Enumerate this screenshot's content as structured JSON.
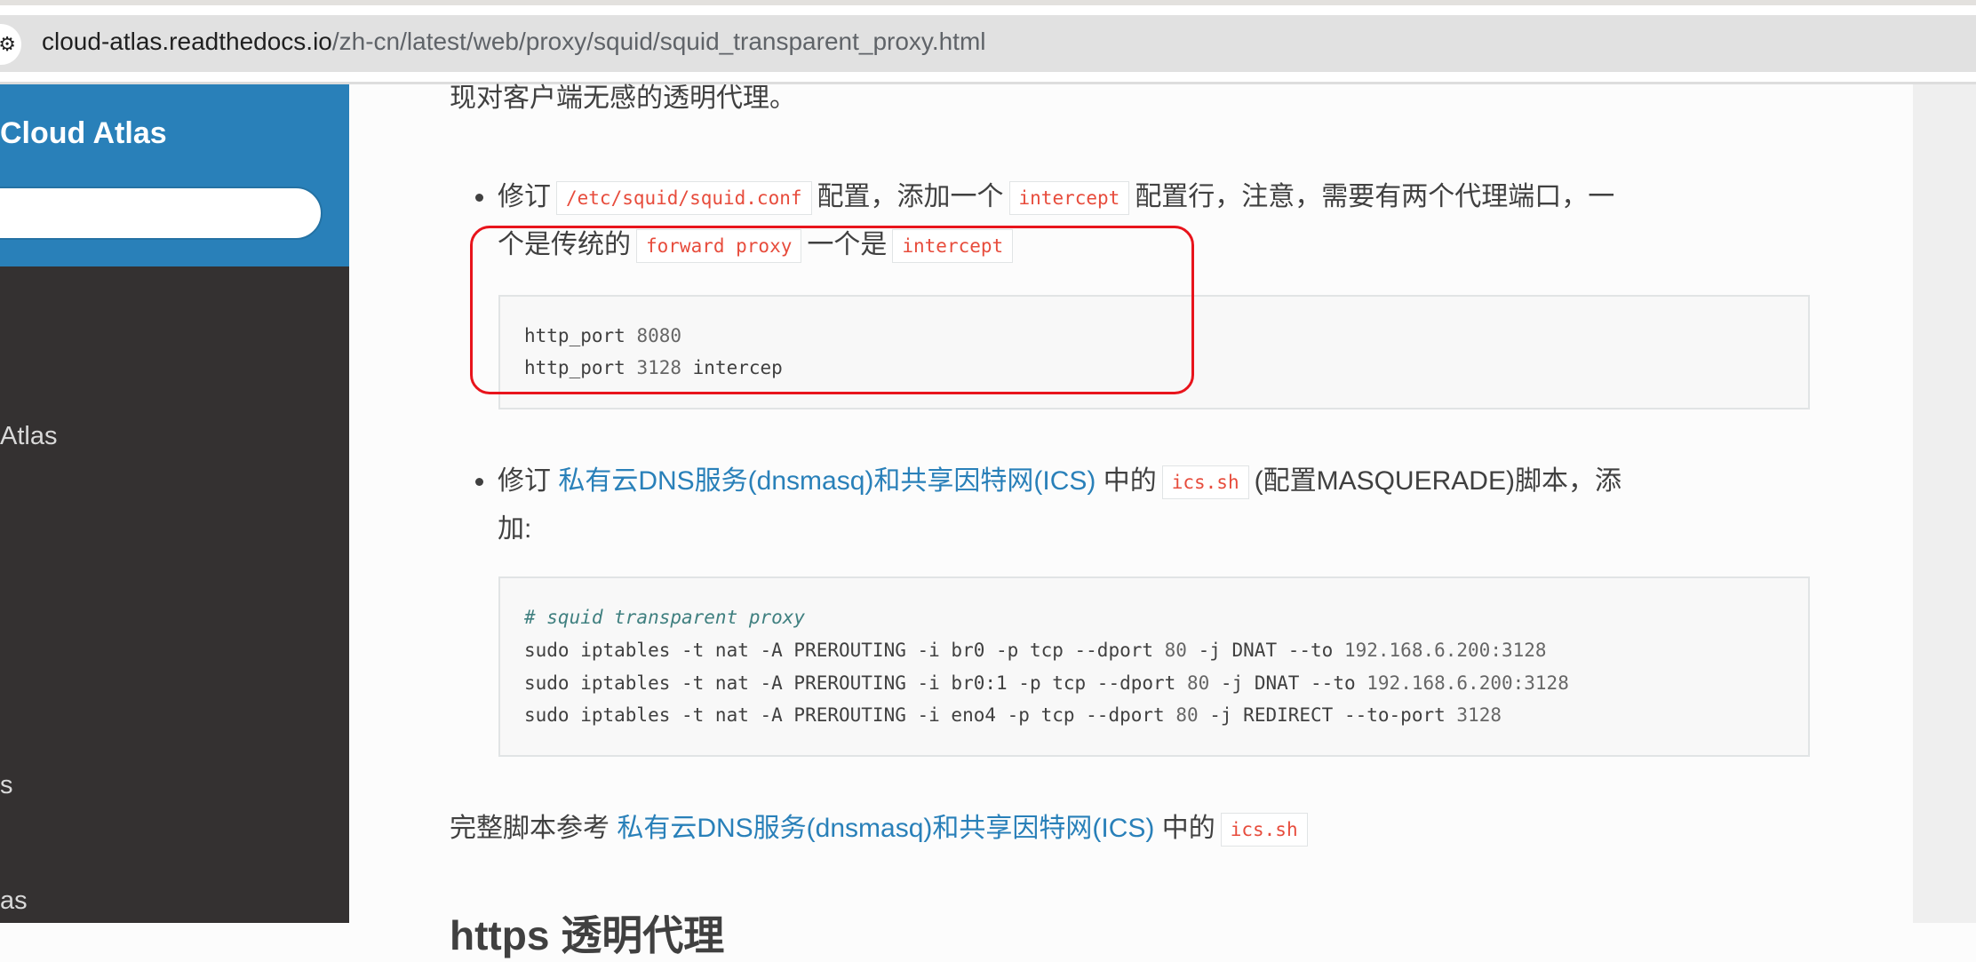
{
  "browser": {
    "site_icon": "site-settings-icon",
    "url_host": "cloud-atlas.readthedocs.io",
    "url_path": "/zh-cn/latest/web/proxy/squid/squid_transparent_proxy.html"
  },
  "sidebar": {
    "brand": "Cloud Atlas",
    "search_placeholder": "",
    "items": [
      "Atlas",
      "s",
      "as"
    ]
  },
  "content": {
    "intro": "现对客户端无感的透明代理。",
    "bullet1": {
      "t1": "修订",
      "c1": "/etc/squid/squid.conf",
      "t2": "配置，添加一个",
      "c2": "intercept",
      "t3": "配置行，注意，需要有两个代理端口，一",
      "t4": "个是传统的",
      "c3": "forward proxy",
      "t5": "一个是",
      "c4": "intercept"
    },
    "code1": [
      {
        "kw": "http_port ",
        "num": "8080",
        "rest": ""
      },
      {
        "kw": "http_port ",
        "num": "3128",
        "rest": " intercep"
      }
    ],
    "bullet2": {
      "t1": "修订",
      "link": "私有云DNS服务(dnsmasq)和共享因特网(ICS)",
      "t2": "中的",
      "c1": "ics.sh",
      "t3": "(配置MASQUERADE)脚本，添",
      "t4": "加:"
    },
    "code2": {
      "comment": "# squid transparent proxy",
      "lines": [
        {
          "a": "sudo iptables -t nat -A PREROUTING -i br0 -p tcp --dport ",
          "n1": "80",
          "b": " -j DNAT --to ",
          "n2": "192.168.6.200:3128"
        },
        {
          "a": "sudo iptables -t nat -A PREROUTING -i br0:1 -p tcp --dport ",
          "n1": "80",
          "b": " -j DNAT --to ",
          "n2": "192.168.6.200:3128"
        },
        {
          "a": "sudo iptables -t nat -A PREROUTING -i eno4 -p tcp --dport ",
          "n1": "80",
          "b": " -j REDIRECT --to-port ",
          "n2": "3128"
        }
      ]
    },
    "para": {
      "t1": "完整脚本参考",
      "link": "私有云DNS服务(dnsmasq)和共享因特网(ICS)",
      "t2": "中的",
      "c1": "ics.sh"
    },
    "heading": "https 透明代理"
  },
  "colors": {
    "sidebar_top": "#2980b9",
    "sidebar": "#343131",
    "link": "#2980b9",
    "literal": "#e74c3c",
    "annotation_box": "#e8141c"
  }
}
